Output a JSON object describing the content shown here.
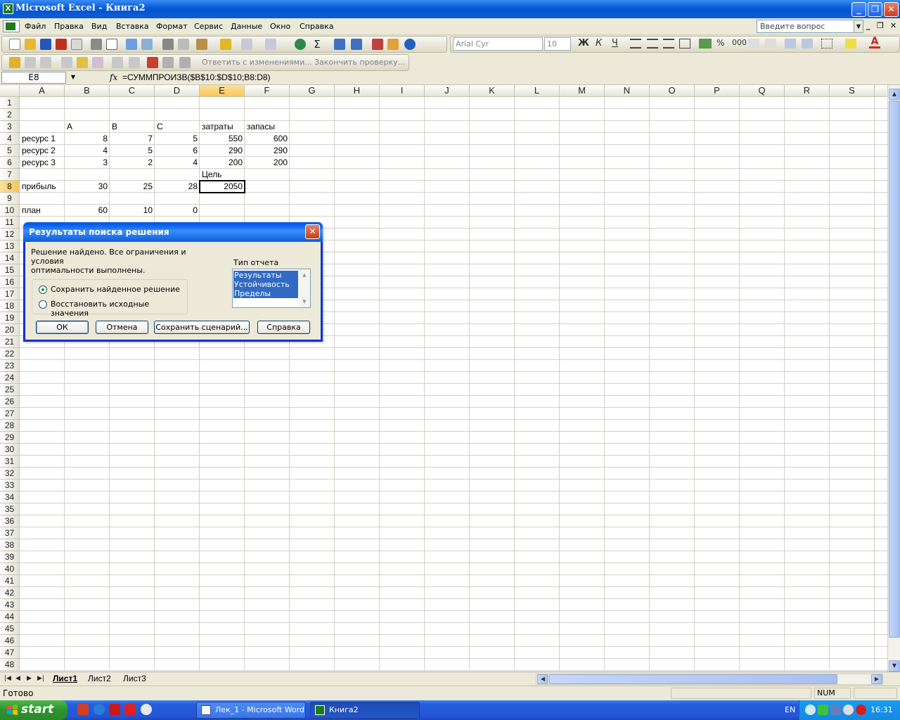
{
  "window": {
    "title": "Microsoft Excel - Книга2",
    "app_icon": "excel-icon"
  },
  "menu": {
    "items": [
      "Файл",
      "Правка",
      "Вид",
      "Вставка",
      "Формат",
      "Сервис",
      "Данные",
      "Окно",
      "Справка"
    ],
    "ask_placeholder": "Введите вопрос"
  },
  "toolbar": {
    "font_name": "Arial Cyr",
    "font_size": "10",
    "bold": "Ж",
    "italic": "К",
    "underline": "Ч",
    "percent": "%",
    "thousands": "000",
    "reply_text": "Ответить с изменениями...",
    "end_review": "Закончить проверку..."
  },
  "formula_bar": {
    "name_box": "E8",
    "fx": "fx",
    "formula": "=СУММПРОИЗВ($B$10:$D$10;B8:D8)"
  },
  "sheet": {
    "columns": [
      "A",
      "B",
      "C",
      "D",
      "E",
      "F",
      "G",
      "H",
      "I",
      "J",
      "K",
      "L",
      "M",
      "N",
      "O",
      "P",
      "Q",
      "R",
      "S"
    ],
    "rows": [
      "1",
      "2",
      "3",
      "4",
      "5",
      "6",
      "7",
      "8",
      "9",
      "10",
      "11",
      "12",
      "13",
      "14",
      "15",
      "16",
      "17",
      "18",
      "19",
      "20",
      "21",
      "22",
      "23",
      "24",
      "25",
      "26",
      "27",
      "28",
      "29",
      "30",
      "31",
      "32",
      "33",
      "34",
      "35",
      "36",
      "37",
      "38",
      "39",
      "40",
      "41",
      "42",
      "43",
      "44",
      "45",
      "46",
      "47",
      "48"
    ],
    "selected_col": "E",
    "selected_row": "8",
    "cells": {
      "B3": "A",
      "C3": "B",
      "D3": "C",
      "E3": "затраты",
      "F3": "запасы",
      "A4": "ресурс 1",
      "B4": "8",
      "C4": "7",
      "D4": "5",
      "E4": "550",
      "F4": "600",
      "A5": "ресурс 2",
      "B5": "4",
      "C5": "5",
      "D5": "6",
      "E5": "290",
      "F5": "290",
      "A6": "ресурс 3",
      "B6": "3",
      "C6": "2",
      "D6": "4",
      "E6": "200",
      "F6": "200",
      "E7": "Цель",
      "A8": "прибыль",
      "B8": "30",
      "C8": "25",
      "D8": "28",
      "E8": "2050",
      "A10": "план",
      "B10": "60",
      "C10": "10",
      "D10": "0"
    }
  },
  "tabs": {
    "sheets": [
      "Лист1",
      "Лист2",
      "Лист3"
    ],
    "active": "Лист1"
  },
  "status": {
    "text": "Готово",
    "num": "NUM"
  },
  "dialog": {
    "title": "Результаты поиска решения",
    "message_line1": "Решение найдено. Все ограничения и условия",
    "message_line2": "оптимальности выполнены.",
    "option_keep": "Сохранить найденное решение",
    "option_restore": "Восстановить исходные значения",
    "report_type_label": "Тип отчета",
    "reports": [
      "Результаты",
      "Устойчивость",
      "Пределы"
    ],
    "btn_ok": "ОК",
    "btn_cancel": "Отмена",
    "btn_save_scenario": "Сохранить сценарий...",
    "btn_help": "Справка"
  },
  "taskbar": {
    "start": "start",
    "tasks": [
      "Лек_1 - Microsoft Word",
      "Книга2"
    ],
    "lang": "EN",
    "clock": "16:31"
  },
  "colors": {
    "title_blue": "#0a5fd8",
    "select_orange": "#f8c558",
    "list_select": "#316ac5",
    "start_green": "#2e922e"
  }
}
